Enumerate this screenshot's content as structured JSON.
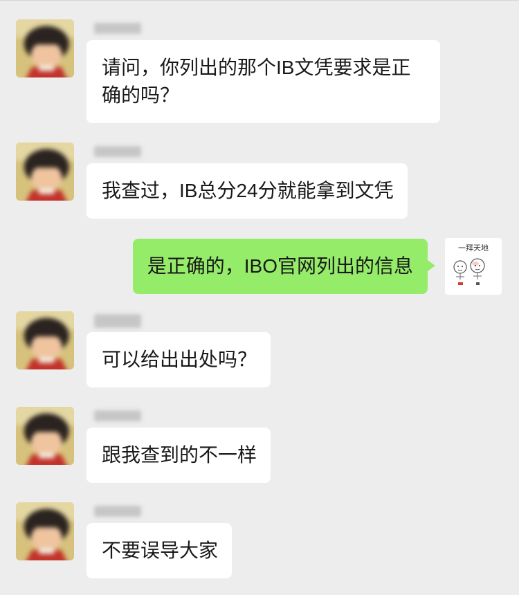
{
  "colors": {
    "background": "#ededed",
    "incoming_bubble": "#ffffff",
    "outgoing_bubble": "#95ec69",
    "text": "#191919"
  },
  "icons": {
    "incoming_avatar": "cartoon-girl-avatar",
    "outgoing_avatar": "couple-sticker-avatar"
  },
  "chat": {
    "messages": [
      {
        "text": "请问，你列出的那个IB文凭要求是正确的吗？"
      },
      {
        "text": "我查过，IB总分24分就能拿到文凭"
      },
      {
        "text": "是正确的，IBO官网列出的信息"
      },
      {
        "text": "可以给出出处吗？"
      },
      {
        "text": "跟我查到的不一样"
      },
      {
        "text": "不要误导大家"
      }
    ]
  },
  "outgoing_avatar": {
    "sticker_text": "一拜天地"
  }
}
